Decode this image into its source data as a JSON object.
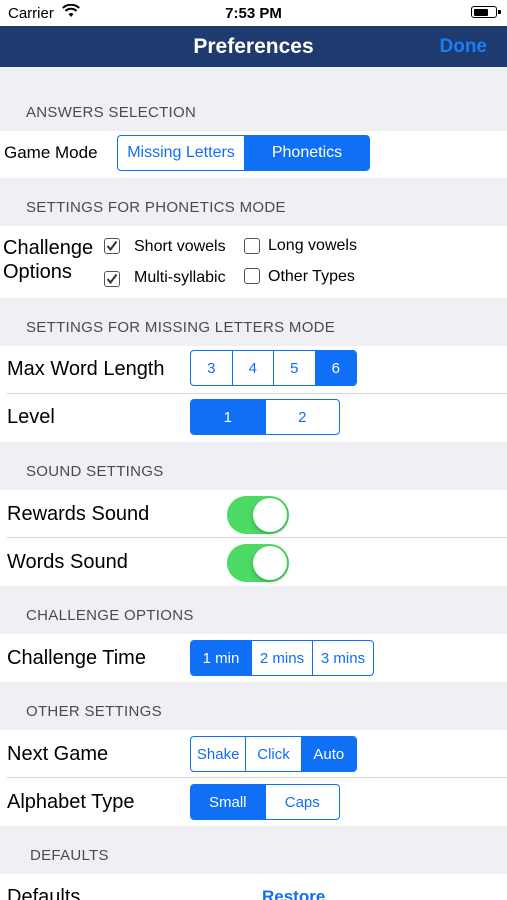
{
  "status_bar": {
    "carrier": "Carrier",
    "time": "7:53 PM"
  },
  "nav": {
    "title": "Preferences",
    "done": "Done"
  },
  "answers_selection": {
    "header": "ANSWERS SELECTION",
    "game_mode_label": "Game Mode",
    "options": [
      "Missing Letters",
      "Phonetics"
    ],
    "selected": "Phonetics"
  },
  "phonetics": {
    "header": "SETTINGS FOR PHONETICS MODE",
    "label_line1": "Challenge",
    "label_line2": "Options",
    "checkboxes": [
      {
        "label": "Short vowels",
        "checked": true
      },
      {
        "label": "Long vowels",
        "checked": false
      },
      {
        "label": "Multi-syllabic",
        "checked": true
      },
      {
        "label": "Other Types",
        "checked": false
      }
    ]
  },
  "missing_letters": {
    "header": "SETTINGS FOR MISSING LETTERS MODE",
    "max_word_length_label": "Max Word Length",
    "max_word_length_options": [
      "3",
      "4",
      "5",
      "6"
    ],
    "max_word_length_selected": "6",
    "level_label": "Level",
    "level_options": [
      "1",
      "2"
    ],
    "level_selected": "1"
  },
  "sound": {
    "header": "SOUND SETTINGS",
    "rewards_label": "Rewards Sound",
    "rewards_on": true,
    "words_label": "Words Sound",
    "words_on": true
  },
  "challenge": {
    "header": "CHALLENGE OPTIONS",
    "time_label": "Challenge Time",
    "time_options": [
      "1 min",
      "2 mins",
      "3 mins"
    ],
    "time_selected": "1 min"
  },
  "other": {
    "header": "OTHER SETTINGS",
    "next_game_label": "Next Game",
    "next_game_options": [
      "Shake",
      "Click",
      "Auto"
    ],
    "next_game_selected": "Auto",
    "alphabet_label": "Alphabet Type",
    "alphabet_options": [
      "Small",
      "Caps"
    ],
    "alphabet_selected": "Small"
  },
  "defaults": {
    "header": "DEFAULTS",
    "label": "Defaults",
    "restore": "Restore"
  },
  "colors": {
    "nav_bg": "#1f3a6e",
    "accent": "#0f6ff5",
    "toggle_on": "#4cd964"
  }
}
